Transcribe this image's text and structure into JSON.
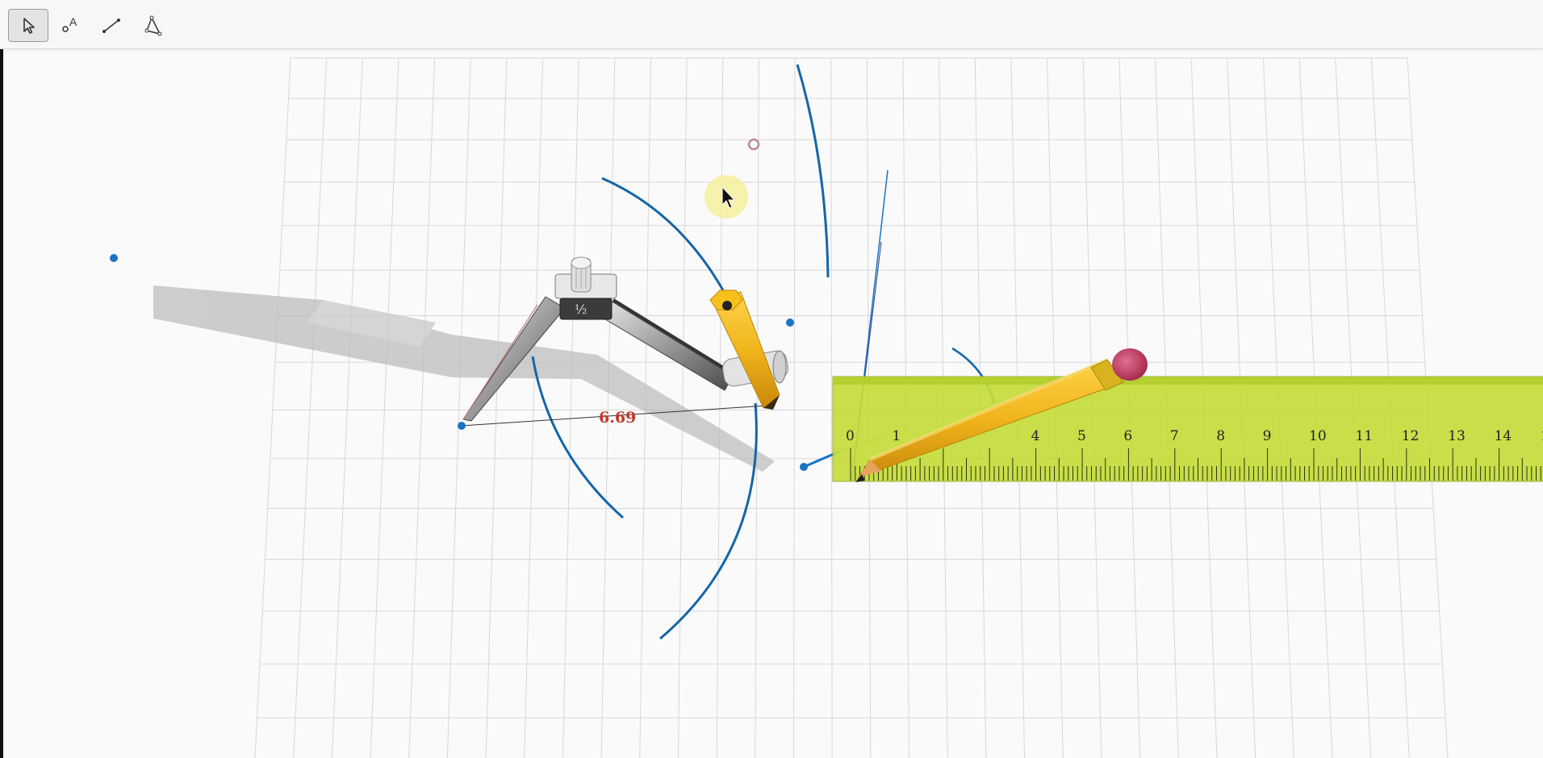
{
  "toolbar": {
    "tools": [
      {
        "name": "select-tool",
        "icon": "cursor-arrow-icon",
        "active": true
      },
      {
        "name": "point-tool",
        "icon": "point-label-icon",
        "label": "A",
        "active": false
      },
      {
        "name": "segment-tool",
        "icon": "line-segment-icon",
        "active": false
      },
      {
        "name": "polygon-tool",
        "icon": "polygon-icon",
        "active": false
      }
    ]
  },
  "canvas": {
    "distance_label": "6.69",
    "compass_hinge_label": "½",
    "ruler": {
      "numbers": [
        "0",
        "1",
        "4",
        "5",
        "6",
        "7",
        "8",
        "9",
        "10",
        "11",
        "12",
        "13",
        "14",
        "1"
      ],
      "color": "#c5dc3a"
    },
    "colors": {
      "arc": "#1565a8",
      "point": "#1a73c4",
      "label": "#c0392b",
      "pencil": "#f0b51c",
      "eraser": "#c9406a",
      "cursor_highlight": "#f4ef9c"
    }
  }
}
